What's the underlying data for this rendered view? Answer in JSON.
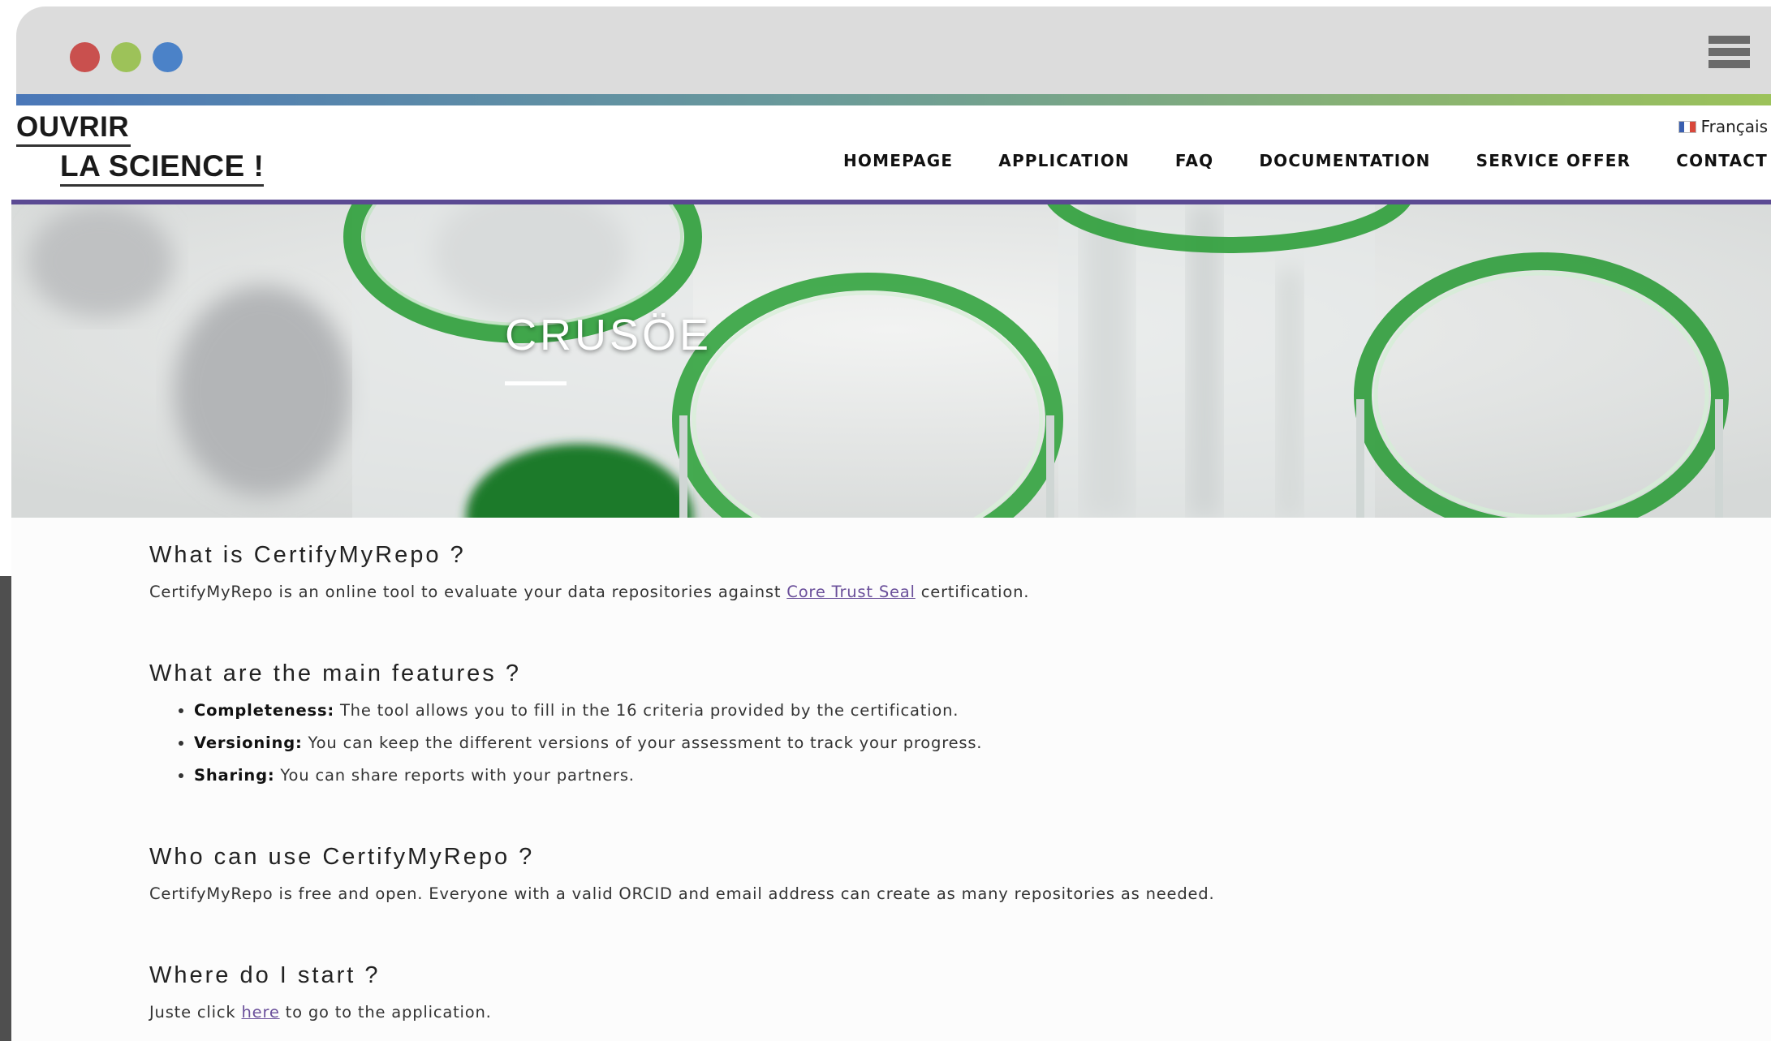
{
  "browser": {
    "window_controls": [
      "close",
      "minimize",
      "maximize"
    ],
    "menu_icon": "hamburger-icon"
  },
  "header": {
    "logo_line1": "OUVRIR",
    "logo_line2": "LA SCIENCE !",
    "language": "Français",
    "nav": [
      "HOMEPAGE",
      "APPLICATION",
      "FAQ",
      "DOCUMENTATION",
      "SERVICE OFFER",
      "CONTACT"
    ]
  },
  "hero": {
    "title": "CRUSÖE"
  },
  "sections": {
    "what": {
      "heading": "What is CertifyMyRepo ?",
      "text_before": "CertifyMyRepo is an online tool to evaluate your data repositories against ",
      "link": "Core Trust Seal",
      "text_after": " certification."
    },
    "features": {
      "heading": "What are the main features ?",
      "items": [
        {
          "label": "Completeness:",
          "text": " The tool allows you to fill in the 16 criteria provided by the certification."
        },
        {
          "label": "Versioning:",
          "text": " You can keep the different versions of your assessment to track your progress."
        },
        {
          "label": "Sharing:",
          "text": " You can share reports with your partners."
        }
      ]
    },
    "who": {
      "heading": "Who can use CertifyMyRepo ?",
      "text": "CertifyMyRepo is free and open. Everyone with a valid ORCID and email address can create as many repositories as needed."
    },
    "start": {
      "heading": "Where do I start ?",
      "text_before": "Juste click ",
      "link": "here",
      "text_after": " to go to the application."
    }
  },
  "colors": {
    "accent_purple": "#5b4a93",
    "link": "#6a4f9a",
    "gradient_start": "#4a77b8",
    "gradient_end": "#9cc25a"
  }
}
